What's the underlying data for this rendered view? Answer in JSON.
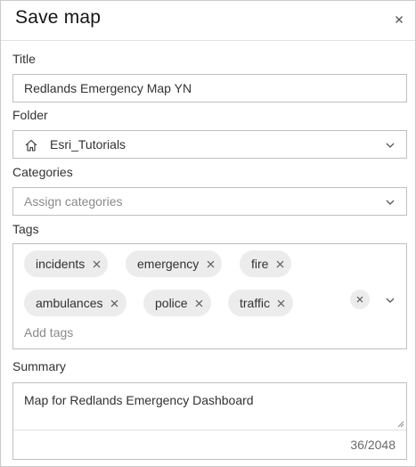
{
  "dialog": {
    "title": "Save map",
    "close_icon": "close-icon"
  },
  "title_field": {
    "label": "Title",
    "value": "Redlands Emergency Map YN"
  },
  "folder_field": {
    "label": "Folder",
    "value": "Esri_Tutorials",
    "icon": "home-icon"
  },
  "categories_field": {
    "label": "Categories",
    "placeholder": "Assign categories"
  },
  "tags_field": {
    "label": "Tags",
    "tags": [
      "incidents",
      "emergency",
      "fire",
      "ambulances",
      "police",
      "traffic"
    ],
    "placeholder": "Add tags"
  },
  "summary_field": {
    "label": "Summary",
    "value": "Map for Redlands Emergency Dashboard",
    "counter": "36/2048"
  }
}
